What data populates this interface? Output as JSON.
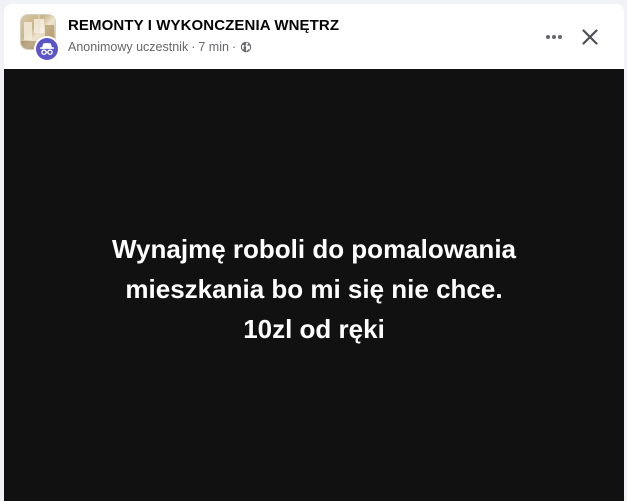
{
  "group": {
    "name": "REMONTY I WYKONCZENIA WNĘTRZ",
    "avatar_icon": "group-photo-icon"
  },
  "author": {
    "name": "Anonimowy uczestnik",
    "badge_icon": "anonymous-member-icon",
    "badge_color": "#5b55c8"
  },
  "post": {
    "time": "7 min",
    "separator": "·",
    "audience_icon": "globe-icon",
    "text_lines": [
      "Wynajmę roboli do pomalowania",
      "mieszkania bo mi się nie chce.",
      "10zl od ręki"
    ],
    "background_color": "#111111",
    "text_color": "#ffffff"
  },
  "actions": {
    "more_icon": "more-options-icon",
    "close_icon": "close-icon"
  }
}
